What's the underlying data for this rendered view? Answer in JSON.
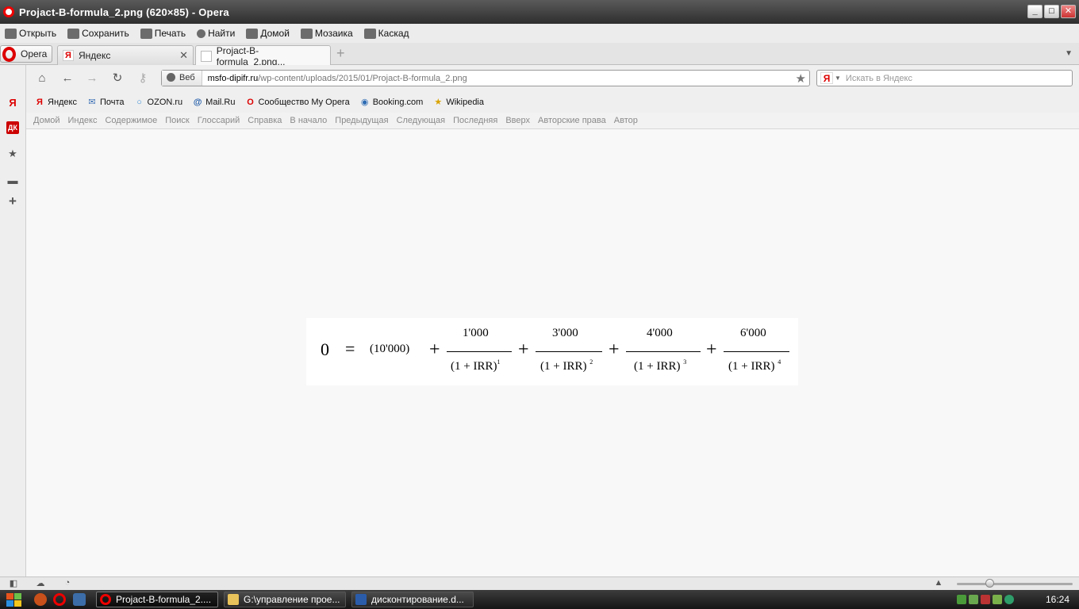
{
  "window": {
    "title": "Projact-B-formula_2.png (620×85) - Opera"
  },
  "menubar": {
    "items": [
      "Открыть",
      "Сохранить",
      "Печать",
      "Найти",
      "Домой",
      "Мозаика",
      "Каскад"
    ]
  },
  "tabs": {
    "opera_label": "Opera",
    "items": [
      {
        "label": "Яндекс",
        "favicon": "Я"
      },
      {
        "label": "Projact-B-formula_2.png..."
      }
    ]
  },
  "address": {
    "mode_label": "Веб",
    "url_domain": "msfo-dipifr.ru",
    "url_path": "/wp-content/uploads/2015/01/Projact-B-formula_2.png",
    "search_engine_badge": "Я",
    "search_placeholder": "Искать в Яндекс"
  },
  "bookmarks": [
    {
      "label": "Яндекс",
      "icon": "yandex-icon"
    },
    {
      "label": "Почта",
      "icon": "mail-icon"
    },
    {
      "label": "OZON.ru",
      "icon": "ozon-icon"
    },
    {
      "label": "Mail.Ru",
      "icon": "at-icon"
    },
    {
      "label": "Сообщество My Opera",
      "icon": "opera-icon"
    },
    {
      "label": "Booking.com",
      "icon": "globe-icon"
    },
    {
      "label": "Wikipedia",
      "icon": "star-icon"
    }
  ],
  "navlinks": [
    "Домой",
    "Индекс",
    "Содержимое",
    "Поиск",
    "Глоссарий",
    "Справка",
    "В начало",
    "Предыдущая",
    "Следующая",
    "Последняя",
    "Вверх",
    "Авторские права",
    "Автор"
  ],
  "sidepanel": {
    "dk_badge": "ДК"
  },
  "formula": {
    "lhs": "0",
    "equals": "=",
    "initial": "(10'000)",
    "plus": "+",
    "terms": [
      {
        "numerator": "1'000",
        "denominator": "(1 + IRR)",
        "power": "1"
      },
      {
        "numerator": "3'000",
        "denominator": "(1 + IRR)",
        "power": "2"
      },
      {
        "numerator": "4'000",
        "denominator": "(1 + IRR)",
        "power": "3"
      },
      {
        "numerator": "6'000",
        "denominator": "(1 + IRR)",
        "power": "4"
      }
    ]
  },
  "taskbar": {
    "tasks": [
      {
        "label": "Projact-B-formula_2...."
      },
      {
        "label": "G:\\управление прое..."
      },
      {
        "label": "дисконтирование.d..."
      }
    ],
    "clock": "16:24"
  }
}
